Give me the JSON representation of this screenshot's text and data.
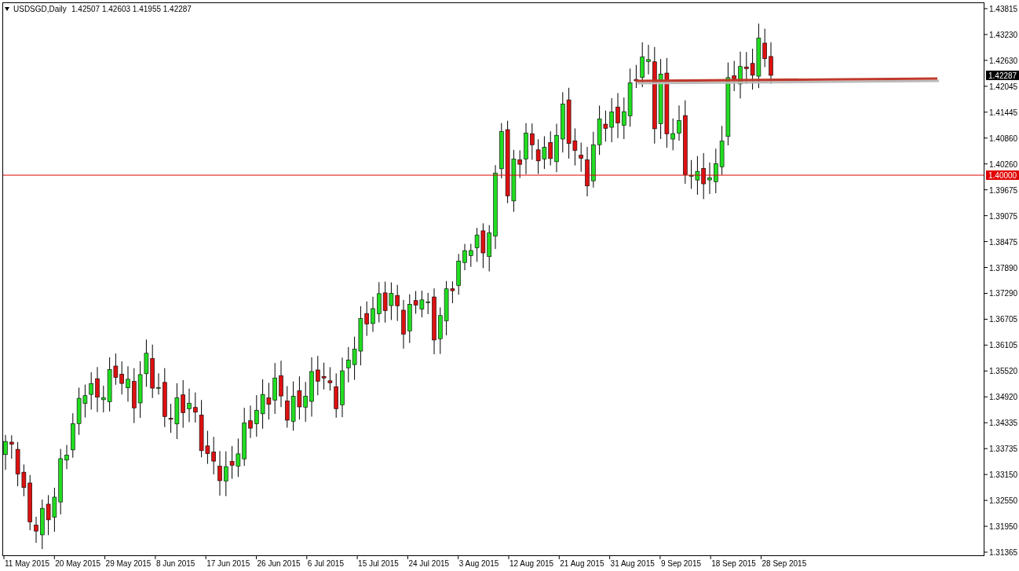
{
  "chart_header": {
    "symbol_label": "USDSGD,Daily",
    "ohlc": [
      "1.42507",
      "1.42603",
      "1.41955",
      "1.42287"
    ]
  },
  "price_axis": {
    "ticks": [
      "1.43815",
      "1.43230",
      "1.42630",
      "1.42045",
      "1.41445",
      "1.40860",
      "1.40260",
      "1.39675",
      "1.39075",
      "1.38475",
      "1.37890",
      "1.37290",
      "1.36705",
      "1.36105",
      "1.35520",
      "1.34920",
      "1.34335",
      "1.33735",
      "1.33150",
      "1.32550",
      "1.31950",
      "1.31365"
    ],
    "current_price": "1.42287",
    "level_line": "1.40000"
  },
  "time_axis": {
    "ticks": [
      "11 May 2015",
      "20 May 2015",
      "29 May 2015",
      "8 Jun 2015",
      "17 Jun 2015",
      "26 Jun 2015",
      "6 Jul 2015",
      "15 Jul 2015",
      "24 Jul 2015",
      "3 Aug 2015",
      "12 Aug 2015",
      "21 Aug 2015",
      "31 Aug 2015",
      "9 Sep 2015",
      "18 Sep 2015",
      "28 Sep 2015"
    ]
  }
}
